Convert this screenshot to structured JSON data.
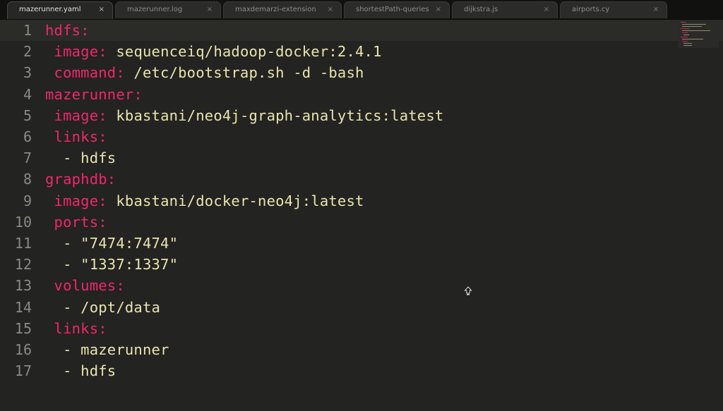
{
  "tabs": [
    {
      "label": "mazerunner.yaml",
      "close": "×",
      "active": true
    },
    {
      "label": "mazerunner.log",
      "close": "×",
      "active": false
    },
    {
      "label": "maxdemarzi-extension",
      "close": "×",
      "active": false
    },
    {
      "label": "shortestPath-queries",
      "close": "×",
      "active": false
    },
    {
      "label": "dijkstra.js",
      "close": "×",
      "active": false
    },
    {
      "label": "airports.cy",
      "close": "×",
      "active": false
    }
  ],
  "editor": {
    "lines": [
      {
        "num": "1",
        "indent": "",
        "key": "hdfs:",
        "value": ""
      },
      {
        "num": "2",
        "indent": " ",
        "key": "image:",
        "value": " sequenceiq/hadoop-docker:2.4.1"
      },
      {
        "num": "3",
        "indent": " ",
        "key": "command:",
        "value": " /etc/bootstrap.sh -d -bash"
      },
      {
        "num": "4",
        "indent": "",
        "key": "mazerunner:",
        "value": ""
      },
      {
        "num": "5",
        "indent": " ",
        "key": "image:",
        "value": " kbastani/neo4j-graph-analytics:latest"
      },
      {
        "num": "6",
        "indent": " ",
        "key": "links:",
        "value": ""
      },
      {
        "num": "7",
        "indent": "  ",
        "key": "",
        "value": "- hdfs"
      },
      {
        "num": "8",
        "indent": "",
        "key": "graphdb:",
        "value": ""
      },
      {
        "num": "9",
        "indent": " ",
        "key": "image:",
        "value": " kbastani/docker-neo4j:latest"
      },
      {
        "num": "10",
        "indent": " ",
        "key": "ports:",
        "value": ""
      },
      {
        "num": "11",
        "indent": "  ",
        "key": "",
        "value": "- \"7474:7474\""
      },
      {
        "num": "12",
        "indent": "  ",
        "key": "",
        "value": "- \"1337:1337\""
      },
      {
        "num": "13",
        "indent": " ",
        "key": "volumes:",
        "value": ""
      },
      {
        "num": "14",
        "indent": "  ",
        "key": "",
        "value": "- /opt/data"
      },
      {
        "num": "15",
        "indent": " ",
        "key": "links:",
        "value": ""
      },
      {
        "num": "16",
        "indent": "  ",
        "key": "",
        "value": "- mazerunner"
      },
      {
        "num": "17",
        "indent": "  ",
        "key": "",
        "value": "- hdfs"
      }
    ]
  },
  "colors": {
    "key": "#f0276f",
    "value": "#e9e4b0",
    "background": "#232321",
    "line_number": "#8a8a84"
  },
  "icons": {
    "mouse_cursor": "move-cursor-icon"
  }
}
